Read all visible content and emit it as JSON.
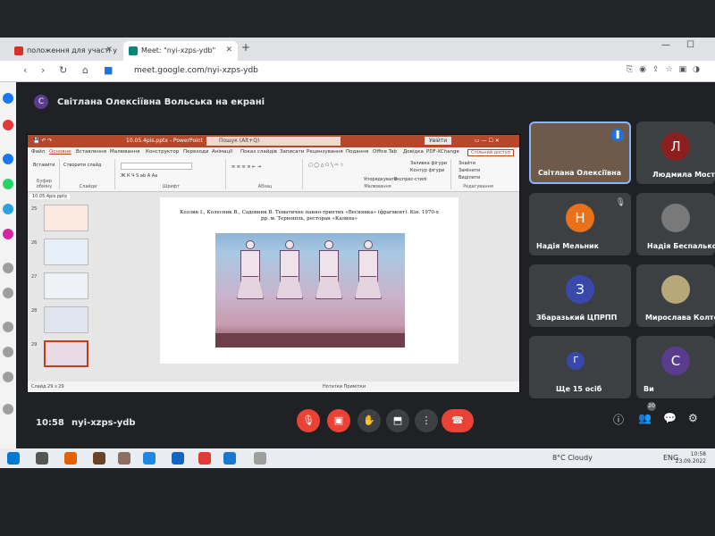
{
  "browser": {
    "tabs": [
      {
        "label": "положення для участі у ..."
      },
      {
        "label": "Meet: \"nyi-xzps-ydb\""
      }
    ],
    "url": "meet.google.com/nyi-xzps-ydb"
  },
  "meet": {
    "presenter_initial": "С",
    "presenter_banner": "Світлана Олексіївна Вольська на екрані",
    "meeting_time": "10:58",
    "meeting_code": "nyi-xzps-ydb",
    "chat_badge": "20",
    "participants": [
      {
        "name": "Світлана Олексіївна",
        "initial": "",
        "color": "#6d5a4a"
      },
      {
        "name": "Людмила Мостова",
        "initial": "Л",
        "color": "#8b1f1f"
      },
      {
        "name": "Надія Мельник",
        "initial": "Н",
        "color": "#e8711a"
      },
      {
        "name": "Надія Беспалько",
        "initial": "",
        "color": "#7a7a7a"
      },
      {
        "name": "Збаразький ЦПРПП",
        "initial": "З",
        "color": "#3949ab"
      },
      {
        "name": "Мирослава Колтон",
        "initial": "",
        "color": "#b7a87a"
      },
      {
        "name": "Ще 15 осіб",
        "initial": "Г",
        "color": "#3949ab"
      },
      {
        "name": "Ви",
        "initial": "С",
        "color": "#5a3c8f"
      }
    ]
  },
  "powerpoint": {
    "title": "10.05.4pis.pptx  -  PowerPoint",
    "search": "Пошук (Alt+Q)",
    "signin": "Увійти",
    "menu": [
      "Файл",
      "Основне",
      "Вставлення",
      "Малювання",
      "Конструктор",
      "Переходи",
      "Анімації",
      "Показ слайдів",
      "Записати",
      "Рецензування",
      "Подання",
      "Office Tab",
      "Довідка",
      "PDF-XChange"
    ],
    "share": "Спільний доступ",
    "ribbon_groups": [
      "Буфер обміну",
      "Слайди",
      "Шрифт",
      "Абзац",
      "Малювання",
      "Редагування"
    ],
    "ribbon_items": {
      "paste": "Вставити",
      "new_slide": "Створити слайд",
      "arrange": "Упорядкувати",
      "quick_styles": "Експрес-стилі",
      "fill": "Заливка фігури",
      "outline": "Контур фігури",
      "effects": "Ефекти для фігур",
      "find": "Знайти",
      "replace": "Замінити",
      "select": "Виділити"
    },
    "doc_tab": "10.05.4pis.pptx",
    "slide_numbers": [
      "25",
      "26",
      "27",
      "28",
      "29"
    ],
    "slide_caption": "Козлик І., Колесник В., Садовник В. Тематичне панно-триптих «Веснянка» (фрагмент). Кін. 1970-х рр. м. Тернопіль, ресторан «Калина»",
    "status_left": "Слайд 29 з 29",
    "status_right": "Нотатки    Примітки"
  },
  "taskbar": {
    "weather": "8°C  Cloudy",
    "lang": "ENG",
    "time": "10:58",
    "date": "23.09.2022"
  },
  "colors": {
    "end_call": "#ea4335",
    "powerpoint_accent": "#b7472a",
    "meet_bg": "#202124"
  }
}
